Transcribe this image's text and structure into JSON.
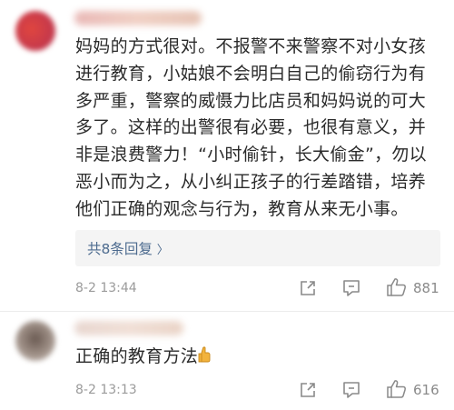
{
  "comments": [
    {
      "text": "妈妈的方式很对。不报警不来警察不对小女孩进行教育，小姑娘不会明白自己的偷窃行为有多严重，警察的威慑力比店员和妈妈说的可大多了。这样的出警很有必要，也很有意义，并非是浪费警力！“小时偷针，长大偷金”，勿以恶小而为之，从小纠正孩子的行差踏错，培养他们正确的观念与行为，教育从来无小事。",
      "replies_label": "共8条回复 ",
      "replies_chevron": "〉",
      "time": "8-2 13:44",
      "likes": "881"
    },
    {
      "text": "正确的教育方法",
      "emoji": "thumbs-up-emoji",
      "time": "8-2 13:13",
      "likes": "616"
    }
  ],
  "icons": {
    "share": "share-icon",
    "comment": "comment-icon",
    "like": "like-icon"
  },
  "colors": {
    "link": "#4d6b8f",
    "meta": "#9b9b9b",
    "icon": "#8a8a8a"
  }
}
